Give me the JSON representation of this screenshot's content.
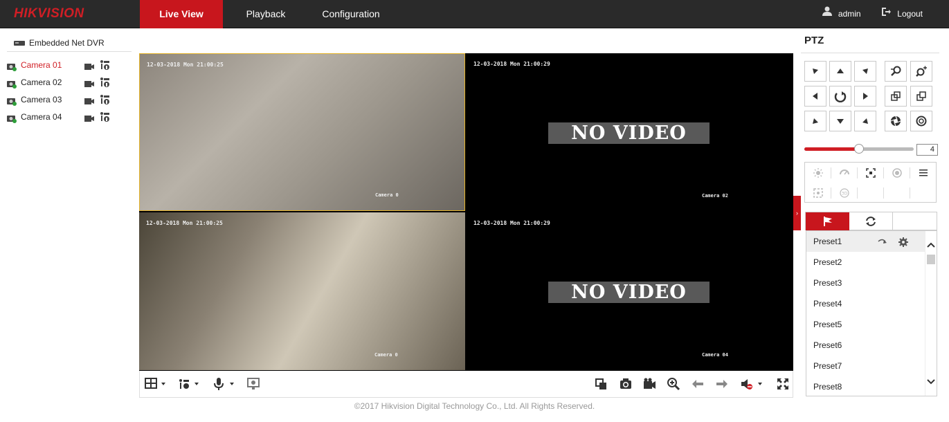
{
  "brand": {
    "logo": "HIKVISION"
  },
  "nav": {
    "tabs": [
      {
        "label": "Live View"
      },
      {
        "label": "Playback"
      },
      {
        "label": "Configuration"
      }
    ]
  },
  "user": {
    "name": "admin",
    "logout": "Logout"
  },
  "sidebar": {
    "device": "Embedded Net DVR",
    "cameras": [
      {
        "label": "Camera 01"
      },
      {
        "label": "Camera 02"
      },
      {
        "label": "Camera 03"
      },
      {
        "label": "Camera 04"
      }
    ]
  },
  "grid": {
    "tiles": [
      {
        "osd": "12-03-2018 Mon 21:00:25",
        "label": "Camera 0",
        "novideo": ""
      },
      {
        "osd": "12-03-2018 Mon 21:00:29",
        "label": "Camera 02",
        "novideo": "NO VIDEO"
      },
      {
        "osd": "12-03-2018 Mon 21:00:25",
        "label": "Camera 0",
        "novideo": ""
      },
      {
        "osd": "12-03-2018 Mon 21:00:29",
        "label": "Camera 04",
        "novideo": "NO VIDEO"
      }
    ]
  },
  "ptz": {
    "title": "PTZ",
    "speed": "4",
    "speed_fraction": 0.5
  },
  "presets": [
    "Preset1",
    "Preset2",
    "Preset3",
    "Preset4",
    "Preset5",
    "Preset6",
    "Preset7",
    "Preset8"
  ],
  "footer": "©2017 Hikvision Digital Technology Co., Ltd. All Rights Reserved.",
  "colors": {
    "accent": "#c8161d",
    "topbar": "#2a2a2a",
    "selected_border": "#e5b327"
  }
}
